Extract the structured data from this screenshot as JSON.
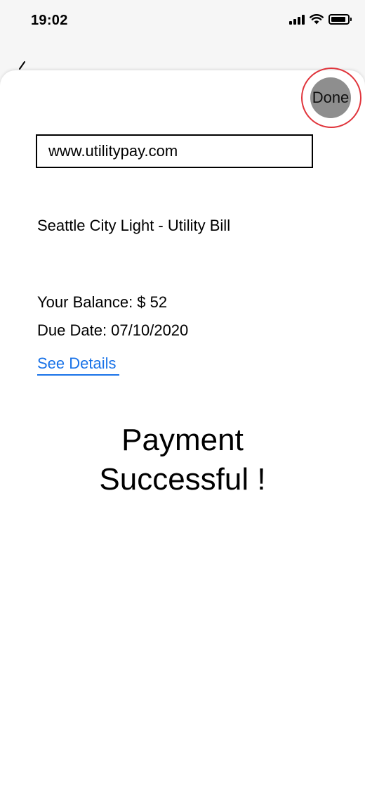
{
  "status_bar": {
    "time": "19:02",
    "icons": [
      "cellular-signal-icon",
      "wifi-icon",
      "battery-icon"
    ]
  },
  "header": {
    "done_label": "Done"
  },
  "browser": {
    "url": "www.utilitypay.com"
  },
  "bill": {
    "title": "Seattle City Light - Utility Bill",
    "balance": "Your Balance: $ 52",
    "due_date": "Due Date: 07/10/2020",
    "details_link": "See Details"
  },
  "confirmation": {
    "line1": "Payment",
    "line2": "Successful !"
  },
  "colors": {
    "link": "#1a73e8",
    "highlight_ring": "#e0343b",
    "done_button_bg": "#8e8e8e"
  }
}
